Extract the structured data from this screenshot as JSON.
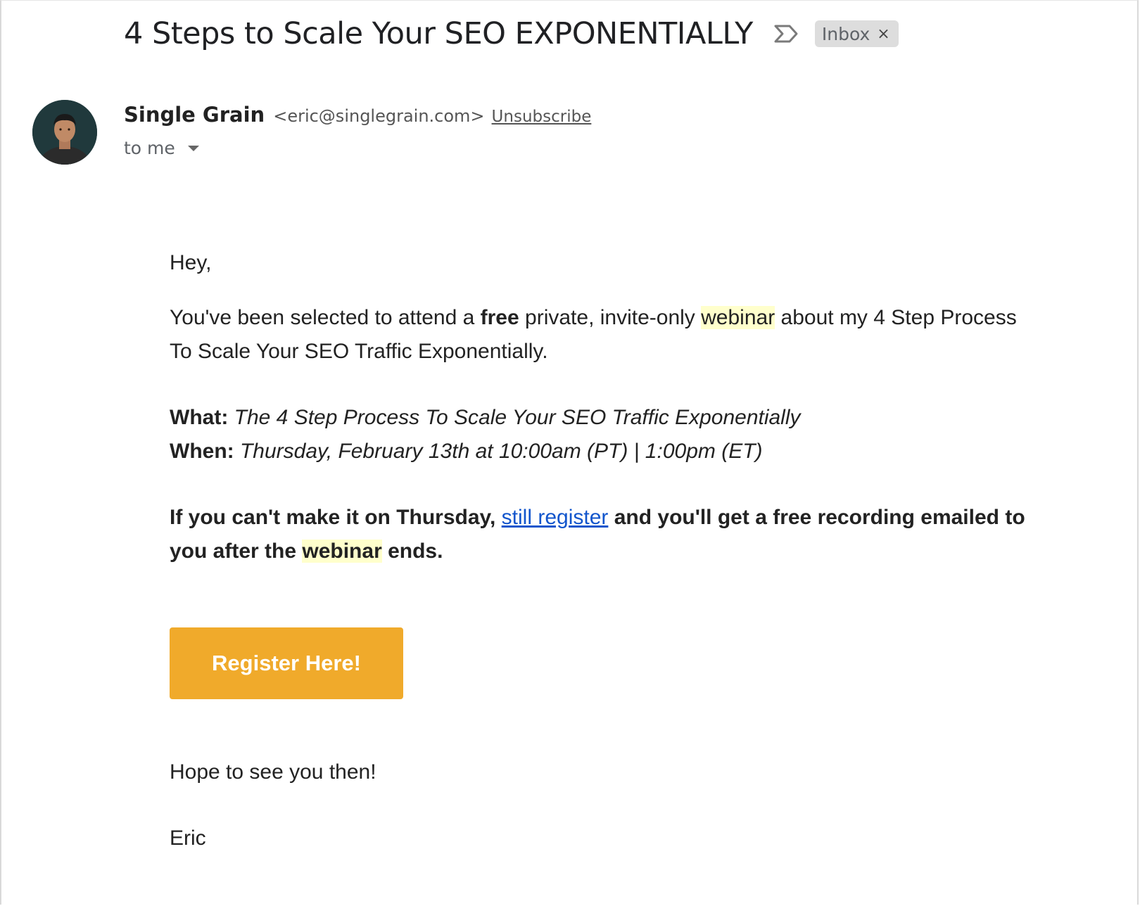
{
  "header": {
    "subject": "4 Steps to Scale Your SEO EXPONENTIALLY",
    "label": "Inbox",
    "label_close": "×",
    "importance_icon": "importance-marker-icon"
  },
  "sender": {
    "name": "Single Grain",
    "email": "<eric@singlegrain.com>",
    "unsubscribe": "Unsubscribe",
    "to": "to me",
    "avatar": "avatar"
  },
  "body": {
    "greeting": "Hey,",
    "intro_1": "You've been selected to attend a ",
    "intro_free": "free",
    "intro_2": " private, invite-only ",
    "intro_webinar": "webinar",
    "intro_3": " about my 4 Step Process To Scale Your SEO Traffic Exponentially.",
    "what_label": "What:",
    "what_value": "The 4 Step Process To Scale Your SEO Traffic Exponentially",
    "when_label": "When:",
    "when_value": "Thursday, February 13th at 10:00am (PT) | 1:00pm (ET)",
    "note_1": "If you can't make it on Thursday, ",
    "note_link": "still register",
    "note_2": " and you'll get a free recording emailed to you after the ",
    "note_webinar": "webinar",
    "note_3": " ends.",
    "cta": "Register Here!",
    "closing": "Hope to see you then!",
    "signature": "Eric"
  },
  "colors": {
    "cta_background": "#f0aa2b",
    "highlight": "#ffffcc",
    "link": "#1155cc",
    "label_chip": "#dddddd"
  }
}
